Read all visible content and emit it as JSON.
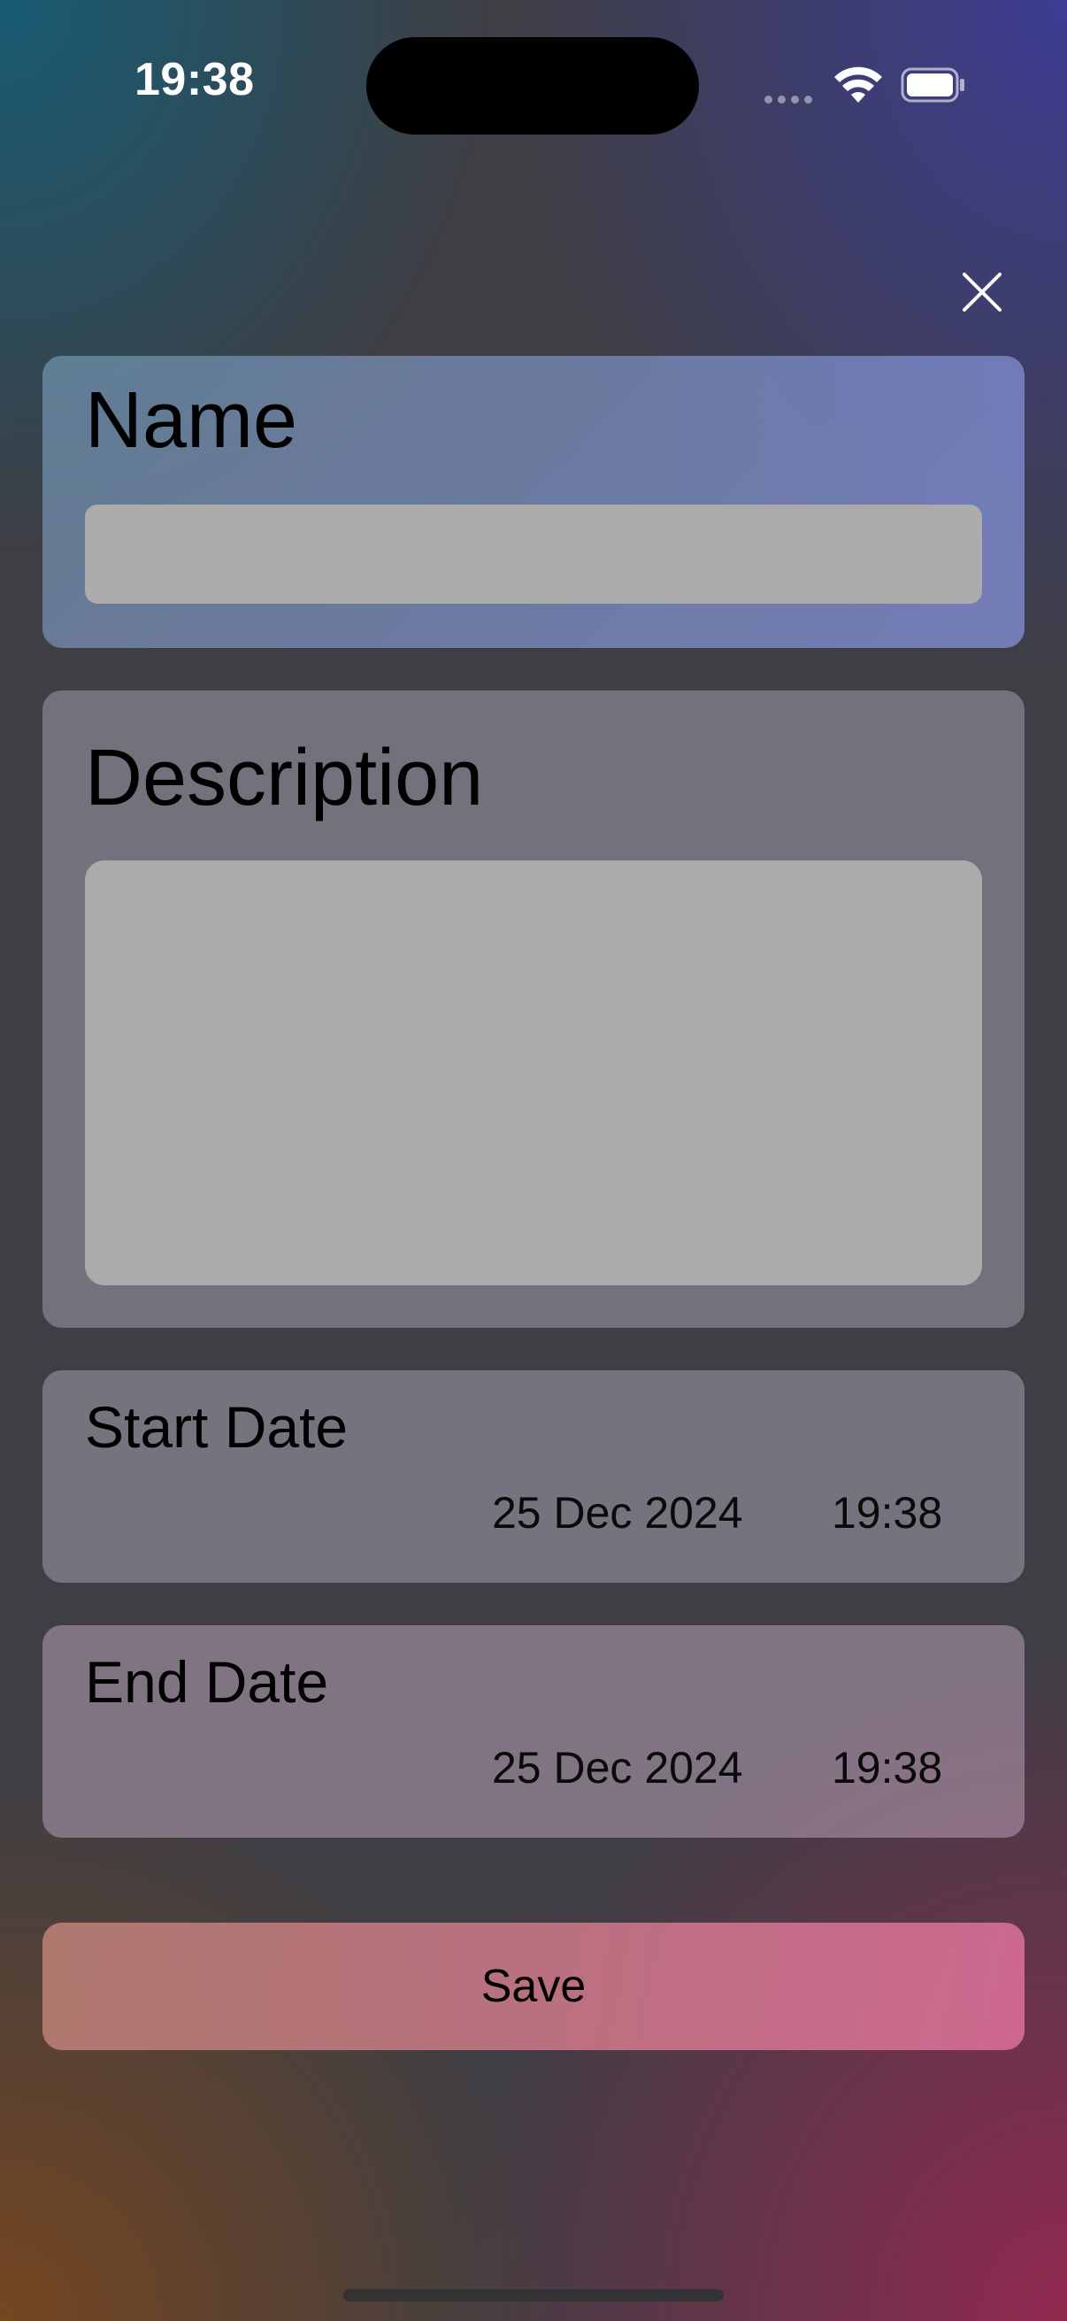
{
  "status_bar": {
    "time": "19:38",
    "wifi_icon": "wifi-icon",
    "battery_icon": "battery-icon",
    "signal_icon": "signal-dots-icon"
  },
  "header": {
    "close_icon": "close-icon"
  },
  "form": {
    "name": {
      "label": "Name",
      "value": "",
      "placeholder": ""
    },
    "description": {
      "label": "Description",
      "value": "",
      "placeholder": ""
    },
    "start_date": {
      "label": "Start Date",
      "date": "25 Dec 2024",
      "time": "19:38"
    },
    "end_date": {
      "label": "End Date",
      "date": "25 Dec 2024",
      "time": "19:38"
    },
    "save_label": "Save"
  }
}
